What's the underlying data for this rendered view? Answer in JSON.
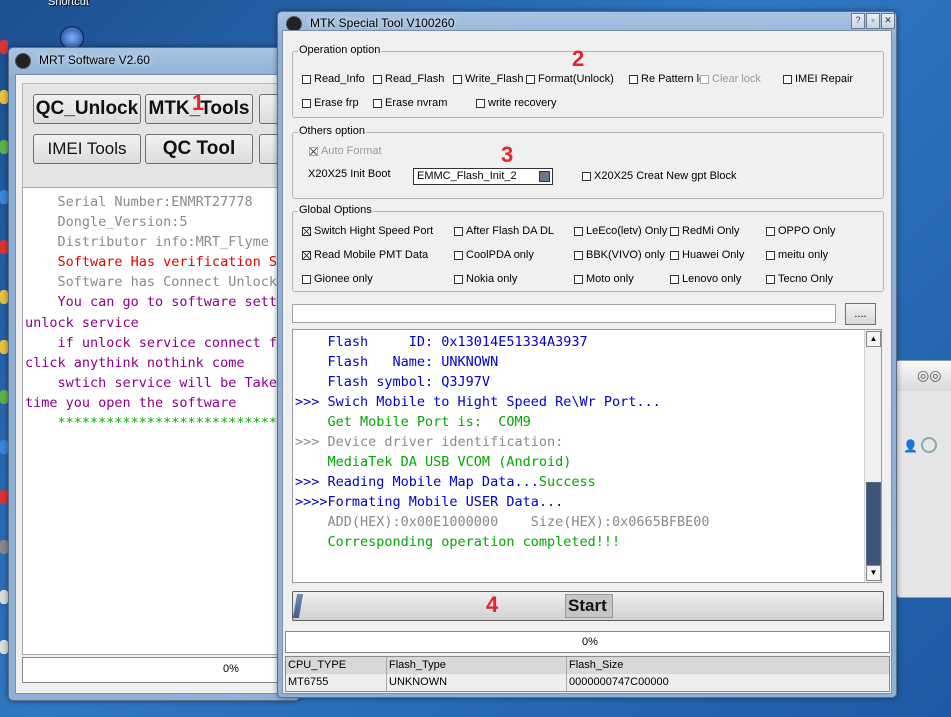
{
  "desktop": {
    "shortcut_label": "Shortcut"
  },
  "mrt_window": {
    "title": "MRT Software V2.60",
    "buttons": {
      "qc_unlock": "QC_Unlock",
      "mtk_tools": "MTK_Tools",
      "imei_tools": "IMEI Tools",
      "qc_tool": "QC Tool"
    },
    "log_lines": [
      {
        "text": "    Serial Number:ENMRT27778",
        "color": "#8a8a8a"
      },
      {
        "text": "    Dongle_Version:5",
        "color": "#8a8a8a"
      },
      {
        "text": "    Distributor info:MRT_Flyme",
        "color": "#8a8a8a"
      },
      {
        "text": "    Software Has verification Su",
        "color": "#e00000"
      },
      {
        "text": "    Software has Connect Unlock",
        "color": "#8a8a8a"
      },
      {
        "text": "    You can go to software setti",
        "color": "#8b008b"
      },
      {
        "text": "unlock service",
        "color": "#8b008b"
      },
      {
        "text": "    if unlock service connect fa",
        "color": "#8b008b"
      },
      {
        "text": "click anythink nothink come",
        "color": "#8b008b"
      },
      {
        "text": "    swtich service will be Take",
        "color": "#8b008b"
      },
      {
        "text": "time you open the software",
        "color": "#8b008b"
      },
      {
        "text": "    ***************************",
        "color": "#00b400"
      }
    ],
    "progress_text": "0%"
  },
  "mtk_window": {
    "title": "MTK Special Tool V100260",
    "operation_option": {
      "title": "Operation option",
      "items": {
        "read_info": "Read_Info",
        "read_flash": "Read_Flash",
        "write_flash": "Write_Flash",
        "format_unlock": "Format(Unlock)",
        "re_pattern": "Re Pattern lo",
        "clear_lock": "Clear lock",
        "imei_repair": "IMEI Repair",
        "erase_frp": "Erase frp",
        "erase_nvram": "Erase nvram",
        "write_recovery": "write recovery"
      }
    },
    "others_option": {
      "title": "Others option",
      "auto_format": "Auto Format",
      "init_boot_label": "X20X25 Init Boot",
      "init_boot_value": "EMMC_Flash_Init_2",
      "gpt_block": "X20X25 Creat New gpt Block"
    },
    "global_options": {
      "title": "Global Options",
      "items": {
        "high_speed": "Switch Hight Speed Port",
        "after_flash": "After Flash DA DL",
        "leeco": "LeEco(letv) Only",
        "redmi": "RedMi Only",
        "oppo": "OPPO Only",
        "read_pmt": "Read Mobile PMT Data",
        "coolpda": "CoolPDA only",
        "bbk": "BBK(VIVO) only",
        "huawei": "Huawei Only",
        "meitu": "meitu only",
        "gionee": "Gionee only",
        "nokia": "Nokia only",
        "moto": "Moto only",
        "lenovo": "Lenovo only",
        "tecno": "Tecno Only"
      }
    },
    "browse_label": "....",
    "log_lines": [
      {
        "text": "    Flash     ID: 0x13014E51334A3937",
        "color": "#0000cc"
      },
      {
        "text": "    Flash   Name: UNKNOWN",
        "color": "#0000cc"
      },
      {
        "text": "    Flash symbol: Q3J97V",
        "color": "#0000cc"
      },
      {
        "text": ">>> Swich Mobile to Hight Speed Re\\Wr Port...",
        "color": "#0000cc"
      },
      {
        "text": "    Get Mobile Port is:  COM9",
        "color": "#00a800"
      },
      {
        "text": ">>> Device driver identification:",
        "color": "#8a8a8a"
      },
      {
        "text": "    MediaTek DA USB VCOM (Android)",
        "color": "#00a800"
      },
      {
        "text": ">>> Reading Mobile Map Data...",
        "color": "#0000cc",
        "suffix": "Success",
        "suffix_color": "#00a800"
      },
      {
        "text": ">>>>Formating Mobile USER Data...",
        "color": "#0000cc"
      },
      {
        "text": "    ADD(HEX):0x00E1000000    Size(HEX):0x0665BFBE00",
        "color": "#8a8a8a"
      },
      {
        "text": "    Corresponding operation completed!!!",
        "color": "#00a800"
      }
    ],
    "start_label": "Start",
    "progress_text": "0%",
    "table": {
      "headers": [
        "CPU_TYPE",
        "Flash_Type",
        "Flash_Size"
      ],
      "row": [
        "MT6755",
        "UNKNOWN",
        "0000000747C00000"
      ]
    }
  },
  "annotations": [
    "1",
    "2",
    "3",
    "4"
  ]
}
